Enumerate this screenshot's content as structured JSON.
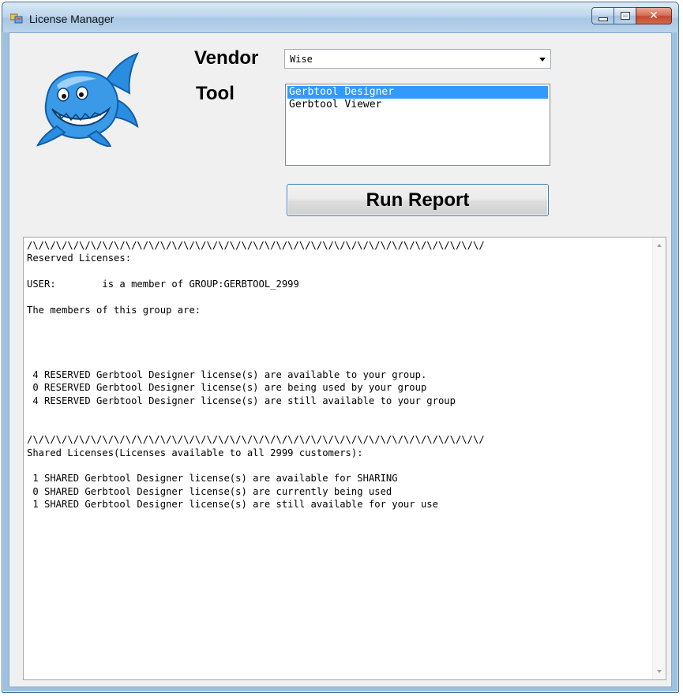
{
  "window": {
    "title": "License Manager",
    "icon": "app-window-icon"
  },
  "form": {
    "vendor_label": "Vendor",
    "tool_label": "Tool",
    "vendor_selected": "Wise",
    "tools": [
      {
        "label": "Gerbtool Designer",
        "selected": true
      },
      {
        "label": "Gerbtool Viewer",
        "selected": false
      }
    ],
    "run_button_label": "Run Report"
  },
  "report": {
    "lines": [
      "/\\/\\/\\/\\/\\/\\/\\/\\/\\/\\/\\/\\/\\/\\/\\/\\/\\/\\/\\/\\/\\/\\/\\/\\/\\/\\/\\/\\/\\/\\/\\/\\/\\/\\/\\/\\/\\/\\/\\/",
      "Reserved Licenses:",
      "",
      "USER:        is a member of GROUP:GERBTOOL_2999",
      "",
      "The members of this group are:",
      "",
      "",
      "",
      "",
      " 4 RESERVED Gerbtool Designer license(s) are available to your group.",
      " 0 RESERVED Gerbtool Designer license(s) are being used by your group",
      " 4 RESERVED Gerbtool Designer license(s) are still available to your group",
      "",
      "",
      "/\\/\\/\\/\\/\\/\\/\\/\\/\\/\\/\\/\\/\\/\\/\\/\\/\\/\\/\\/\\/\\/\\/\\/\\/\\/\\/\\/\\/\\/\\/\\/\\/\\/\\/\\/\\/\\/\\/\\/",
      "Shared Licenses(Licenses available to all 2999 customers):",
      "",
      " 1 SHARED Gerbtool Designer license(s) are available for SHARING",
      " 0 SHARED Gerbtool Designer license(s) are currently being used",
      " 1 SHARED Gerbtool Designer license(s) are still available for your use"
    ]
  },
  "colors": {
    "selection": "#3399ff",
    "button_border": "#3c7fb1",
    "logo_blue": "#1f7fd6"
  },
  "icons": {
    "logo": "shark-logo-icon",
    "dropdown": "chevron-down-icon",
    "minimize": "minimize-icon",
    "maximize": "maximize-icon",
    "close": "close-icon"
  }
}
